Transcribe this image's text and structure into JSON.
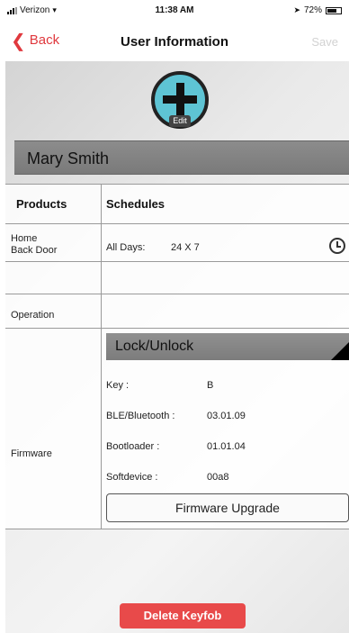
{
  "status_bar": {
    "carrier": "Verizon",
    "time": "11:38 AM",
    "battery_percent": "72%",
    "battery_level": 0.72
  },
  "nav": {
    "back_label": "Back",
    "title": "User Information",
    "save_label": "Save"
  },
  "avatar": {
    "edit_label": "Edit"
  },
  "user": {
    "name": "Mary Smith"
  },
  "table": {
    "headers": {
      "products": "Products",
      "schedules": "Schedules"
    },
    "product": {
      "line1": "Home",
      "line2": "Back Door",
      "schedule_label": "All Days:",
      "schedule_value": "24 X 7"
    },
    "operation": {
      "label": "Operation",
      "selected": "Lock/Unlock"
    },
    "firmware": {
      "label": "Firmware",
      "rows": [
        {
          "key": "Key :",
          "value": "B"
        },
        {
          "key": "BLE/Bluetooth :",
          "value": "03.01.09"
        },
        {
          "key": "Bootloader :",
          "value": "01.01.04"
        },
        {
          "key": "Softdevice :",
          "value": "00a8"
        }
      ],
      "upgrade_label": "Firmware Upgrade"
    }
  },
  "footer": {
    "delete_label": "Delete Keyfob"
  },
  "colors": {
    "accent": "#e0393e",
    "avatar": "#5ec4d4",
    "delete": "#e84a4a"
  }
}
